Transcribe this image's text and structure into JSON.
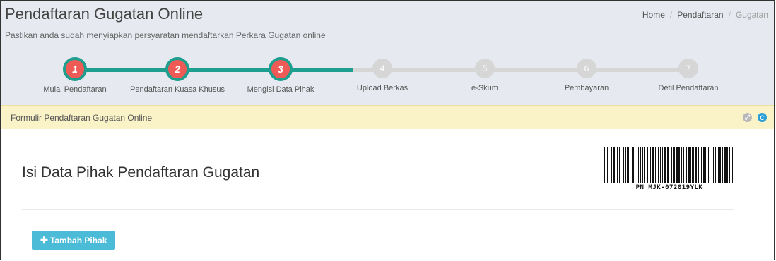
{
  "header": {
    "title": "Pendaftaran Gugatan Online",
    "subtitle": "Pastikan anda sudah menyiapkan persyaratan mendaftarkan Perkara Gugatan online"
  },
  "breadcrumb": [
    "Home",
    "Pendaftaran",
    "Gugatan"
  ],
  "steps": [
    {
      "num": "1",
      "label": "Mulai Pendaftaran",
      "status": "done"
    },
    {
      "num": "2",
      "label": "Pendaftaran Kuasa Khusus",
      "status": "done"
    },
    {
      "num": "3",
      "label": "Mengisi Data Pihak",
      "status": "done"
    },
    {
      "num": "4",
      "label": "Upload Berkas",
      "status": "todo"
    },
    {
      "num": "5",
      "label": "e-Skum",
      "status": "todo"
    },
    {
      "num": "6",
      "label": "Pembayaran",
      "status": "todo"
    },
    {
      "num": "7",
      "label": "Detil Pendaftaran",
      "status": "todo"
    }
  ],
  "panel": {
    "title": "Formulir Pendaftaran Gugatan Online",
    "icons": [
      "expand-icon",
      "collapse-icon"
    ]
  },
  "form": {
    "heading": "Isi Data Pihak Pendaftaran Gugatan",
    "barcode_text": "PN MJK-072019YLK",
    "add_button_label": "Tambah Pihak"
  },
  "colors": {
    "accent_teal": "#1e9e8e",
    "step_done": "#ee5a55",
    "step_todo": "#d6d6d6",
    "panel_header": "#faf3c8",
    "button": "#4bbbd8"
  }
}
